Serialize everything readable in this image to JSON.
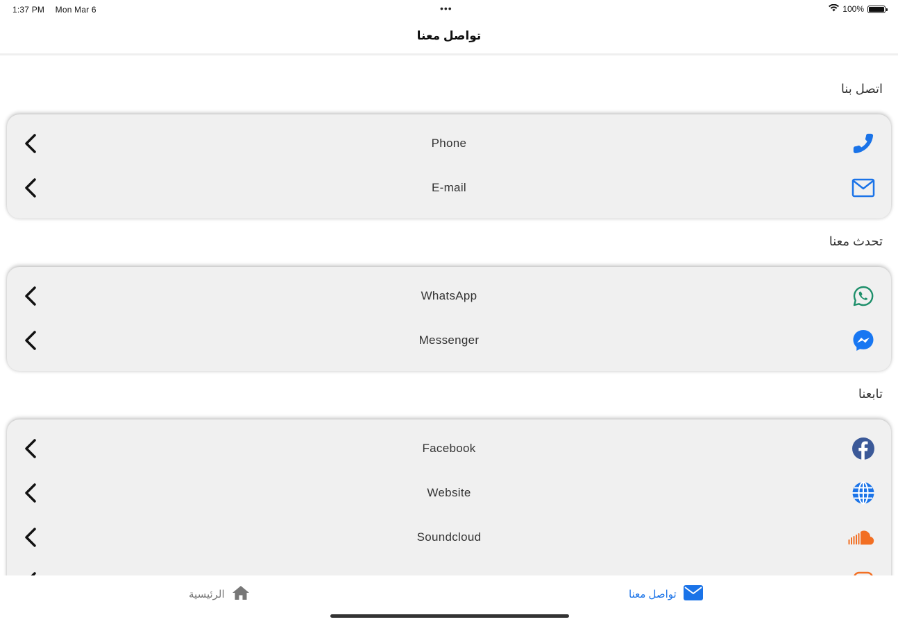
{
  "status_bar": {
    "time": "1:37 PM",
    "date": "Mon Mar 6",
    "dots": "•••",
    "battery_pct": "100%"
  },
  "header": {
    "title": "تواصل معنا"
  },
  "sections": [
    {
      "heading": "اتصل بنا",
      "items": [
        {
          "label": "Phone",
          "icon": "phone-icon"
        },
        {
          "label": "E-mail",
          "icon": "envelope-icon"
        }
      ]
    },
    {
      "heading": "تحدث معنا",
      "items": [
        {
          "label": "WhatsApp",
          "icon": "whatsapp-icon"
        },
        {
          "label": "Messenger",
          "icon": "messenger-icon"
        }
      ]
    },
    {
      "heading": "تابعنا",
      "items": [
        {
          "label": "Facebook",
          "icon": "facebook-icon"
        },
        {
          "label": "Website",
          "icon": "globe-icon"
        },
        {
          "label": "Soundcloud",
          "icon": "soundcloud-icon"
        }
      ]
    }
  ],
  "tab_bar": {
    "contact_label": "تواصل معنا",
    "home_label": "الرئيسية"
  },
  "colors": {
    "accent": "#1a73e8",
    "whatsapp": "#1d8f6a",
    "messenger": "#1877f2",
    "facebook": "#3b5998",
    "soundcloud": "#f26f23",
    "card_bg": "#f0f0f0"
  }
}
